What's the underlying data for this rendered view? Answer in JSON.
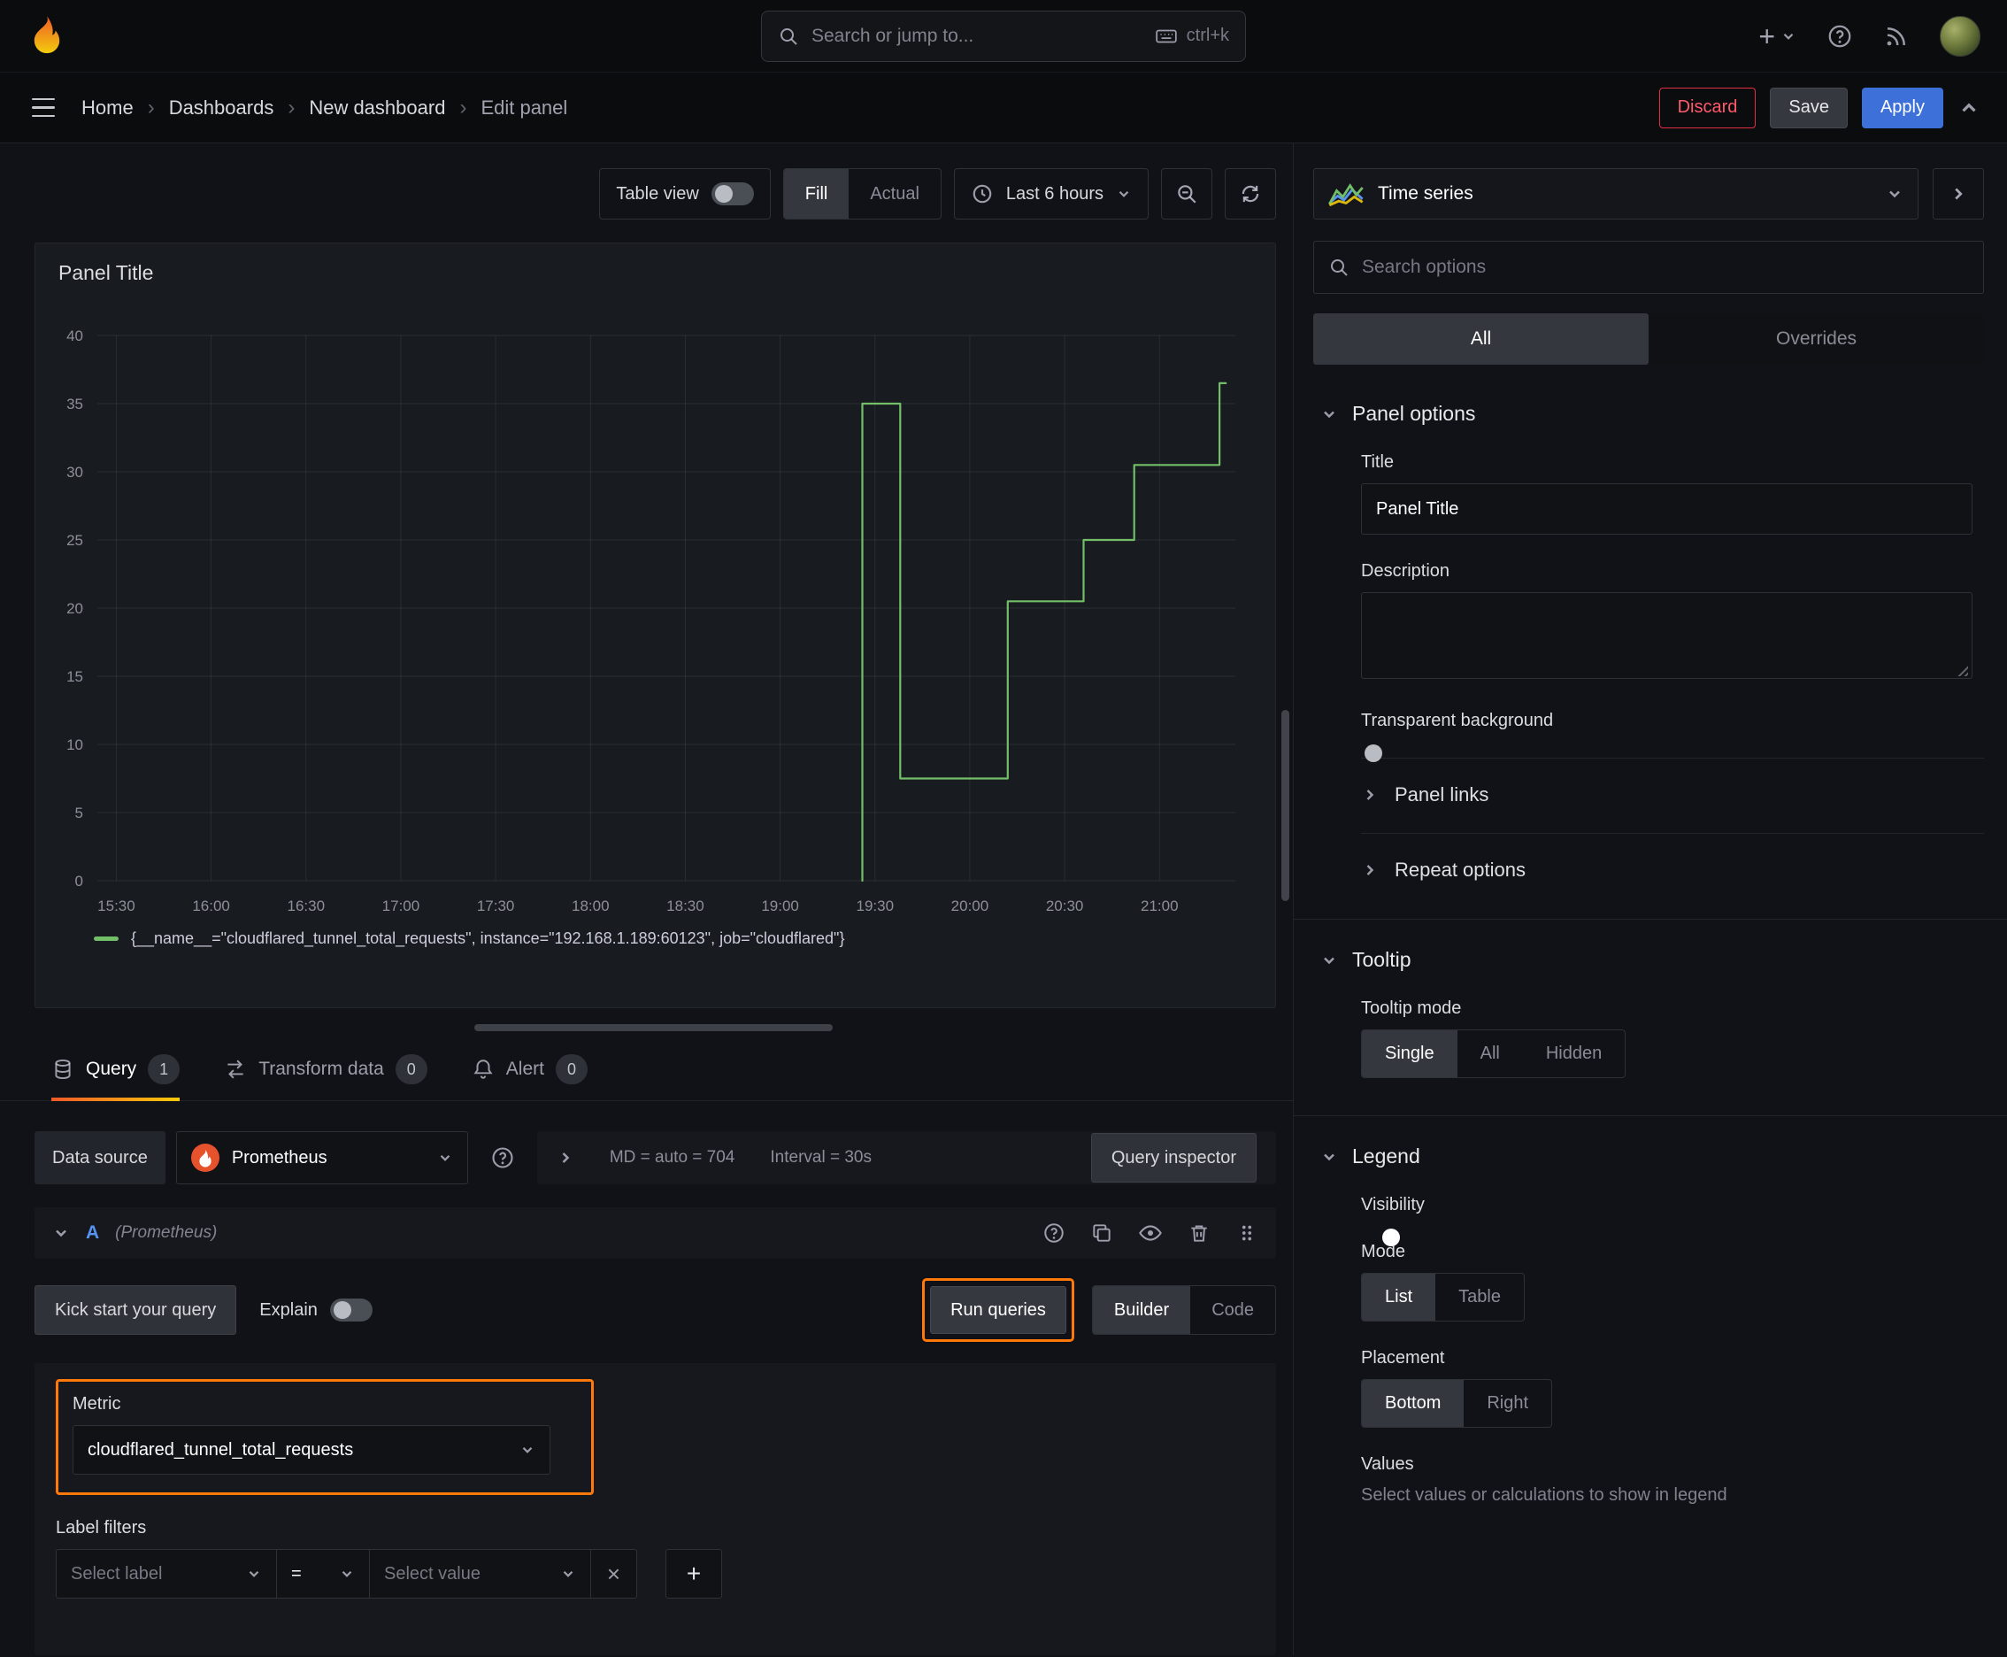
{
  "colors": {
    "accent_orange": "#ff780a",
    "primary_blue": "#3d71d9",
    "destructive_red": "#e02f44",
    "series_green": "#73bf69",
    "tab_underline_gradient": [
      "#f05a28",
      "#fbca0a"
    ]
  },
  "glyphs": {
    "plus": "+",
    "close": "×"
  },
  "topnav": {
    "search_placeholder": "Search or jump to...",
    "search_shortcut": "ctrl+k"
  },
  "breadcrumb": {
    "items": [
      "Home",
      "Dashboards",
      "New dashboard",
      "Edit panel"
    ],
    "separator": "›",
    "discard_label": "Discard",
    "save_label": "Save",
    "apply_label": "Apply"
  },
  "toolbar": {
    "table_view_label": "Table view",
    "display_modes": [
      "Fill",
      "Actual"
    ],
    "active_display_mode": "Fill",
    "time_range_label": "Last 6 hours"
  },
  "panel": {
    "title": "Panel Title"
  },
  "chart_data": {
    "type": "line",
    "step": true,
    "title": "Panel Title",
    "xlabel": "",
    "ylabel": "",
    "x_ticks": [
      "15:30",
      "16:00",
      "16:30",
      "17:00",
      "17:30",
      "18:00",
      "18:30",
      "19:00",
      "19:30",
      "20:00",
      "20:30",
      "21:00"
    ],
    "y_ticks": [
      0,
      5,
      10,
      15,
      20,
      25,
      30,
      35,
      40
    ],
    "ylim": [
      0,
      40
    ],
    "x_range": [
      "15:24",
      "21:24"
    ],
    "grid": true,
    "legend_position": "bottom",
    "series": [
      {
        "name": "{__name__=\"cloudflared_tunnel_total_requests\", instance=\"192.168.1.189:60123\", job=\"cloudflared\"}",
        "color": "#73bf69",
        "points": [
          [
            "19:26",
            0
          ],
          [
            "19:26",
            35
          ],
          [
            "19:38",
            35
          ],
          [
            "19:38",
            7.5
          ],
          [
            "20:12",
            7.5
          ],
          [
            "20:12",
            20.5
          ],
          [
            "20:36",
            20.5
          ],
          [
            "20:36",
            25
          ],
          [
            "20:52",
            25
          ],
          [
            "20:52",
            30.5
          ],
          [
            "21:19",
            30.5
          ],
          [
            "21:19",
            36.5
          ],
          [
            "21:21",
            36.5
          ]
        ]
      }
    ]
  },
  "tabs": {
    "query": {
      "label": "Query",
      "count": "1"
    },
    "transform": {
      "label": "Transform data",
      "count": "0"
    },
    "alert": {
      "label": "Alert",
      "count": "0"
    }
  },
  "query_editor": {
    "datasource_label": "Data source",
    "datasource_value": "Prometheus",
    "max_data_points": "MD = auto = 704",
    "interval": "Interval = 30s",
    "query_inspector_label": "Query inspector",
    "ref_id": "A",
    "ref_note": "(Prometheus)",
    "kick_start_label": "Kick start your query",
    "explain_label": "Explain",
    "run_queries_label": "Run queries",
    "editor_modes": [
      "Builder",
      "Code"
    ],
    "active_editor_mode": "Builder",
    "metric_label": "Metric",
    "metric_value": "cloudflared_tunnel_total_requests",
    "label_filters_label": "Label filters",
    "select_label_placeholder": "Select label",
    "operator_value": "=",
    "select_value_placeholder": "Select value"
  },
  "sidebar": {
    "viz_name": "Time series",
    "search_placeholder": "Search options",
    "tabs": [
      "All",
      "Overrides"
    ],
    "active_tab": "All",
    "panel_options": {
      "title": "Panel options",
      "title_label": "Title",
      "title_value": "Panel Title",
      "description_label": "Description",
      "description_value": "",
      "transparent_label": "Transparent background",
      "transparent_on": false,
      "panel_links_label": "Panel links",
      "repeat_options_label": "Repeat options"
    },
    "tooltip": {
      "title": "Tooltip",
      "mode_label": "Tooltip mode",
      "modes": [
        "Single",
        "All",
        "Hidden"
      ],
      "active_mode": "Single"
    },
    "legend": {
      "title": "Legend",
      "visibility_label": "Visibility",
      "visibility_on": true,
      "mode_label": "Mode",
      "modes": [
        "List",
        "Table"
      ],
      "active_mode": "List",
      "placement_label": "Placement",
      "placements": [
        "Bottom",
        "Right"
      ],
      "active_placement": "Bottom",
      "values_label": "Values",
      "values_help": "Select values or calculations to show in legend"
    }
  }
}
